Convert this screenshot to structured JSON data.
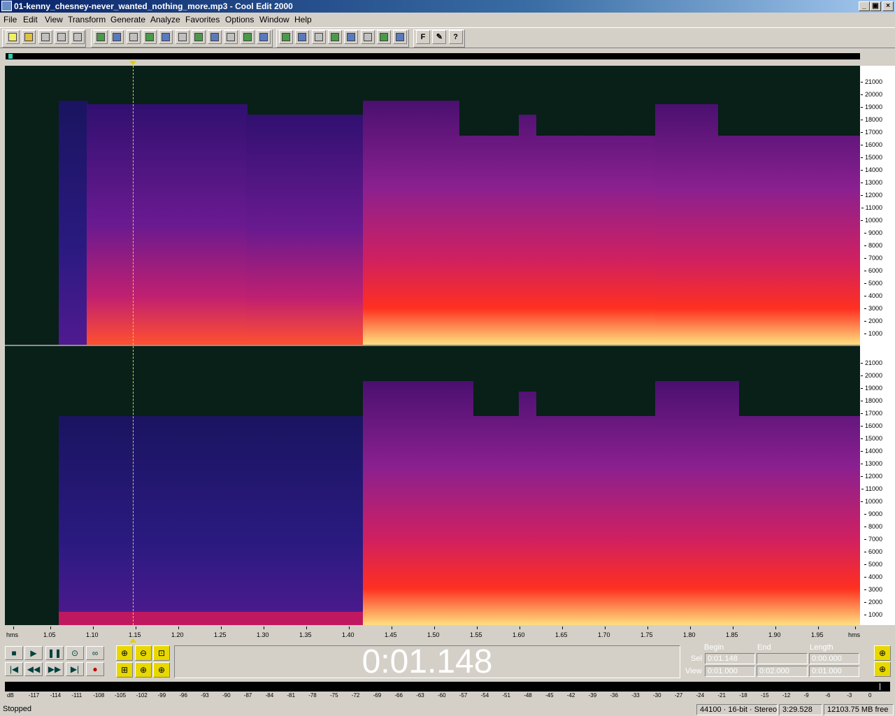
{
  "window": {
    "title": "01-kenny_chesney-never_wanted_nothing_more.mp3 - Cool Edit 2000",
    "minimize": "_",
    "maximize": "▣",
    "close": "×"
  },
  "menu": [
    "File",
    "Edit",
    "View",
    "Transform",
    "Generate",
    "Analyze",
    "Favorites",
    "Options",
    "Window",
    "Help"
  ],
  "toolbar": {
    "file": [
      "new-file-icon",
      "open-file-icon",
      "save-icon",
      "save-as-icon",
      "close-file-icon"
    ],
    "edit": [
      "undo-icon",
      "repeat-icon",
      "cut-icon",
      "select-all-icon",
      "copy-icon",
      "cut-icon",
      "paste-icon",
      "mix-paste-icon",
      "trim-icon",
      "insert-icon",
      "crop-icon"
    ],
    "view": [
      "spectral-view-icon",
      "waveform-view-icon",
      "grid-icon",
      "grid-2-icon",
      "grid-3-icon",
      "info-icon",
      "doc-icon",
      "cd-icon"
    ],
    "misc": [
      "favorites-icon",
      "script-icon",
      "help-icon"
    ],
    "misc_labels": [
      "F",
      "✎",
      "?"
    ]
  },
  "freq_labels": [
    "21000",
    "20000",
    "19000",
    "18000",
    "17000",
    "16000",
    "15000",
    "14000",
    "13000",
    "12000",
    "11000",
    "10000",
    "9000",
    "8000",
    "7000",
    "6000",
    "5000",
    "4000",
    "3000",
    "2000",
    "1000"
  ],
  "time_labels": [
    "hms",
    "1.05",
    "1.10",
    "1.15",
    "1.20",
    "1.25",
    "1.30",
    "1.35",
    "1.40",
    "1.45",
    "1.50",
    "1.55",
    "1.60",
    "1.65",
    "1.70",
    "1.75",
    "1.80",
    "1.85",
    "1.90",
    "1.95",
    "hms"
  ],
  "transport": {
    "buttons": [
      "stop-button",
      "play-button",
      "pause-button",
      "play-to-end-button",
      "loop-button",
      "go-to-start-button",
      "rewind-button",
      "fast-forward-button",
      "go-to-end-button",
      "record-button"
    ],
    "glyphs": [
      "■",
      "▶",
      "❚❚",
      "⊙",
      "∞",
      "|◀",
      "◀◀",
      "▶▶",
      "▶|",
      "●"
    ]
  },
  "zoom": {
    "glyphs": [
      "⊕",
      "⊖",
      "⊡",
      "⊞",
      "⊕",
      "⊕"
    ]
  },
  "time_display": "0:01.148",
  "selection": {
    "headers": {
      "begin": "Begin",
      "end": "End",
      "length": "Length"
    },
    "sel_label": "Sel",
    "view_label": "View",
    "sel_begin": "0:01.148",
    "sel_end": "",
    "sel_length": "0:00.000",
    "view_begin": "0:01.000",
    "view_end": "0:02.000",
    "view_length": "0:01.000"
  },
  "db_labels": [
    "dB",
    "-117",
    "-114",
    "-111",
    "-108",
    "-105",
    "-102",
    "-99",
    "-96",
    "-93",
    "-90",
    "-87",
    "-84",
    "-81",
    "-78",
    "-75",
    "-72",
    "-69",
    "-66",
    "-63",
    "-60",
    "-57",
    "-54",
    "-51",
    "-48",
    "-45",
    "-42",
    "-39",
    "-36",
    "-33",
    "-30",
    "-27",
    "-24",
    "-21",
    "-18",
    "-15",
    "-12",
    "-9",
    "-6",
    "-3",
    "0"
  ],
  "status": {
    "state": "Stopped",
    "format": "44100 · 16-bit · Stereo",
    "duration": "3:29.528",
    "free": "12103.75 MB free"
  },
  "colors": {
    "spectrum_bg": "#082018",
    "title_gradient_start": "#0a246a",
    "panel": "#d4d0c8"
  }
}
